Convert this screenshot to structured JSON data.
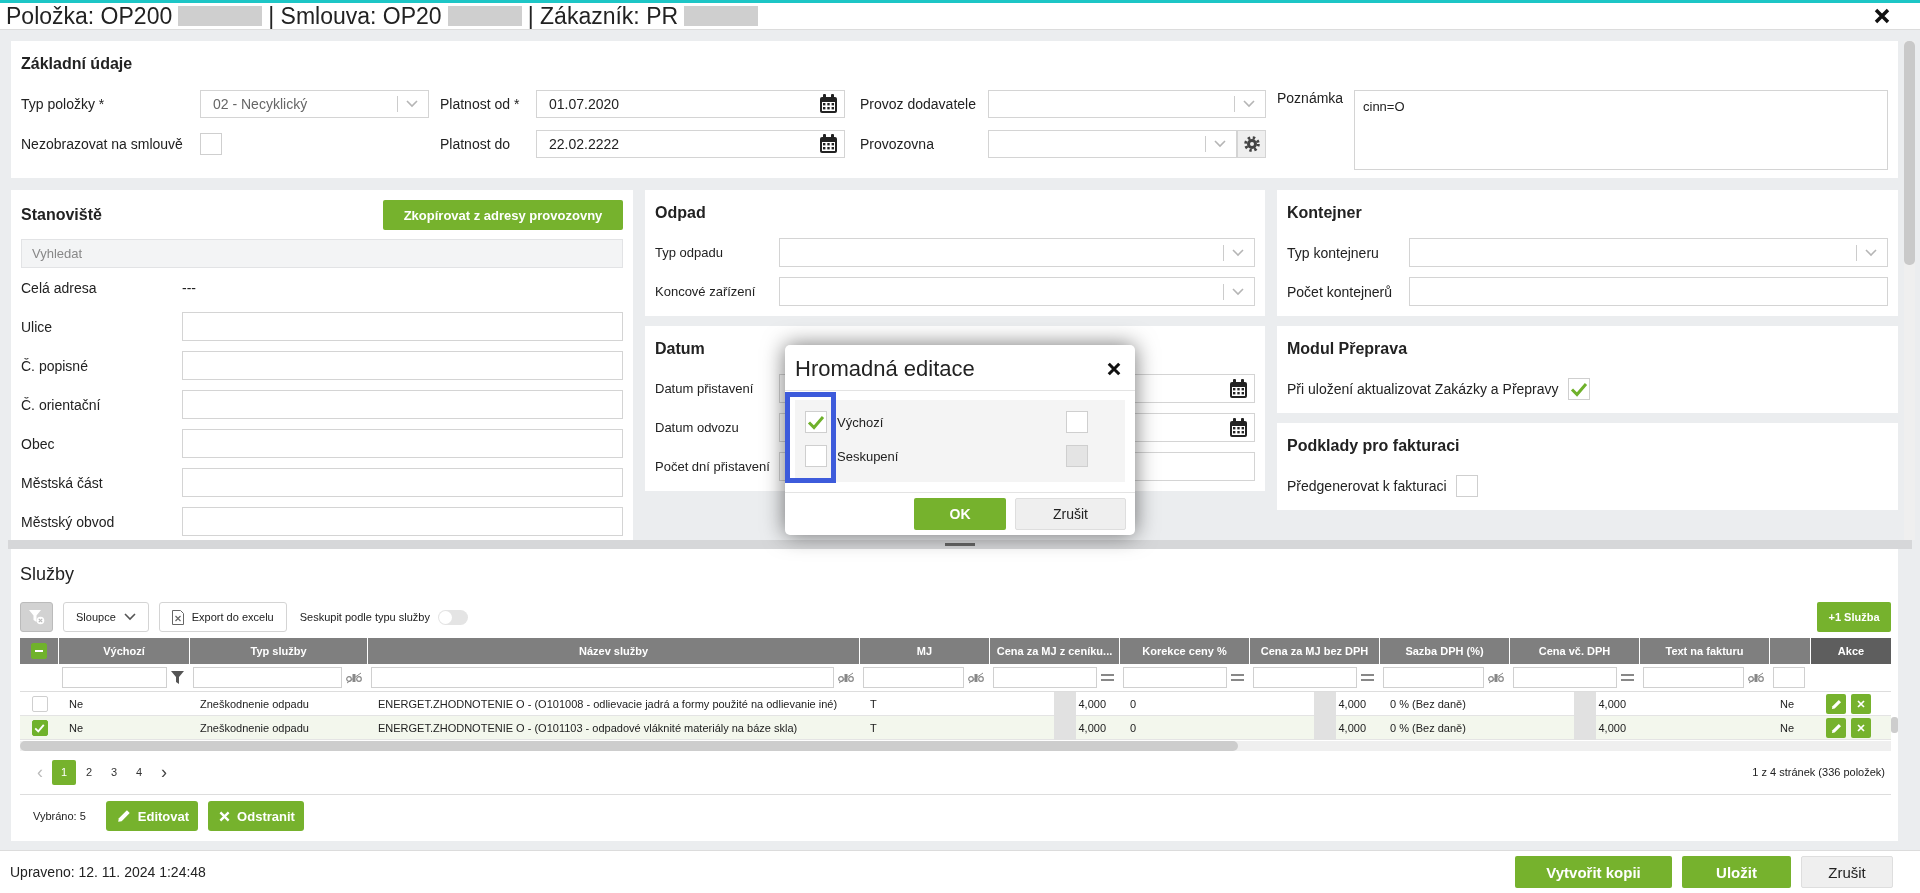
{
  "header": {
    "parts": [
      {
        "text": "Položka: OP200",
        "redacted": true
      },
      {
        "text": "| Smlouva: OP20",
        "redacted": true
      },
      {
        "text": "| Zákazník: PR",
        "redacted": true
      }
    ]
  },
  "basic": {
    "title": "Základní údaje",
    "columns": [
      [
        {
          "kind": "select",
          "label": "Typ položky *",
          "value": "02 - Necyklický",
          "disabled": true
        },
        {
          "kind": "checkbox",
          "label": "Nezobrazovat na smlouvě",
          "checked": false
        }
      ],
      [
        {
          "kind": "date",
          "label": "Platnost od *",
          "value": "01.07.2020"
        },
        {
          "kind": "date",
          "label": "Platnost do",
          "value": "22.02.2222"
        }
      ],
      [
        {
          "kind": "select",
          "label": "Provoz dodavatele"
        },
        {
          "kind": "select-gear",
          "label": "Provozovna"
        }
      ],
      [
        {
          "kind": "textarea",
          "label": "Poznámka",
          "value": "cinn=O"
        }
      ]
    ]
  },
  "panels": [
    [
      {
        "title": "Stanoviště",
        "button": "Zkopírovat z adresy provozovny",
        "search": {
          "placeholder": "Vyhledat"
        },
        "fields": [
          {
            "kind": "text",
            "label": "Celá adresa",
            "value": "---"
          },
          {
            "kind": "input",
            "label": "Ulice"
          },
          {
            "kind": "input",
            "label": "Č. popisné"
          },
          {
            "kind": "input",
            "label": "Č. orientační"
          },
          {
            "kind": "input",
            "label": "Obec"
          },
          {
            "kind": "input",
            "label": "Městská část"
          },
          {
            "kind": "input",
            "label": "Městský obvod"
          }
        ]
      }
    ],
    [
      {
        "title": "Odpad",
        "fields": [
          {
            "kind": "select",
            "label": "Typ odpadu"
          },
          {
            "kind": "select",
            "label": "Koncové zařízení"
          }
        ]
      },
      {
        "title": "Datum",
        "fields": [
          {
            "kind": "date",
            "label": "Datum přistavení"
          },
          {
            "kind": "date",
            "label": "Datum odvozu"
          },
          {
            "kind": "input",
            "label": "Počet dní přistavení"
          }
        ]
      }
    ],
    [
      {
        "title": "Kontejner",
        "fields": [
          {
            "kind": "select",
            "label": "Typ kontejneru"
          },
          {
            "kind": "input",
            "label": "Počet kontejnerů"
          }
        ]
      },
      {
        "title": "Modul Přeprava",
        "fields": [
          {
            "kind": "checkbox",
            "label": "Při uložení aktualizovat Zakázky a Přepravy",
            "checked": true
          }
        ]
      },
      {
        "title": "Podklady pro fakturaci",
        "fields": [
          {
            "kind": "checkbox",
            "label": "Předgenerovat k fakturaci",
            "checked": false
          }
        ]
      }
    ]
  ],
  "services": {
    "title": "Služby",
    "toolbar": {
      "clear_filter": {
        "disabled": true
      },
      "columns_button": "Sloupce",
      "export_button": "Export do excelu",
      "group_toggle": {
        "label": "Seskupit podle typu služby",
        "on": false
      },
      "add_button": "+1 Služba"
    },
    "table": {
      "select_all_partial": true,
      "columns": [
        {
          "label": "Výchozí",
          "kind": "list"
        },
        {
          "label": "Typ služby",
          "kind": "text"
        },
        {
          "label": "Název služby",
          "kind": "text"
        },
        {
          "label": "MJ",
          "kind": "text"
        },
        {
          "label": "Cena za MJ z ceníku...",
          "kind": "number"
        },
        {
          "label": "Korekce ceny %",
          "kind": "number"
        },
        {
          "label": "Cena za MJ bez DPH",
          "kind": "number"
        },
        {
          "label": "Sazba DPH (%)",
          "kind": "text"
        },
        {
          "label": "Cena vč. DPH",
          "kind": "number"
        },
        {
          "label": "Text na fakturu",
          "kind": "text"
        },
        {
          "kind": "plain"
        }
      ],
      "actions_label": "Akce",
      "rows": [
        {
          "selected": false,
          "cells": [
            "Ne",
            "Zneškodnenie odpadu",
            "ENERGET.ZHODNOTENIE O - (O101008 - odlievacie jadrá a formy použité na odlievanie iné)",
            "T",
            {
              "text": "4,000",
              "redacted": true
            },
            "0",
            {
              "text": "4,000",
              "redacted": true
            },
            "0 % (Bez daně)",
            {
              "text": "4,000",
              "redacted": true
            },
            null,
            "Ne"
          ]
        },
        {
          "selected": true,
          "cells": [
            "Ne",
            "Zneškodnenie odpadu",
            "ENERGET.ZHODNOTENIE O - (O101103 - odpadové vláknité materiály na báze skla)",
            "T",
            {
              "text": "4,000",
              "redacted": true
            },
            "0",
            {
              "text": "4,000",
              "redacted": true
            },
            "0 % (Bez daně)",
            {
              "text": "4,000",
              "redacted": true
            },
            null,
            "Ne"
          ]
        }
      ]
    },
    "pager": {
      "prev": {
        "label": "‹",
        "disabled": true
      },
      "pages": [
        {
          "label": "1",
          "selected": true
        },
        {
          "label": "2",
          "selected": false
        },
        {
          "label": "3",
          "selected": false
        },
        {
          "label": "4",
          "selected": false
        }
      ],
      "next": {
        "label": "›",
        "disabled": false
      },
      "summary": "1 z 4 stránek (336 položek)"
    },
    "selection": {
      "count": "Vybráno: 5",
      "buttons": [
        {
          "kind": "edit",
          "label": "Editovat"
        },
        {
          "kind": "delete",
          "label": "Odstranit"
        }
      ]
    }
  },
  "footer": {
    "modified": "Upraveno: 12. 11. 2024 1:24:48",
    "buttons": [
      {
        "label": "Vytvořit kopii",
        "kind": "primary"
      },
      {
        "label": "Uložit",
        "kind": "primary"
      },
      {
        "label": "Zrušit",
        "kind": "secondary"
      }
    ]
  },
  "dialog": {
    "title": "Hromadná editace",
    "highlight": true,
    "rows": [
      {
        "label": "Výchozí",
        "checked": true,
        "value_disabled": false
      },
      {
        "label": "Seskupení",
        "checked": false,
        "value_disabled": true
      }
    ],
    "buttons": [
      {
        "label": "OK",
        "kind": "primary"
      },
      {
        "label": "Zrušit",
        "kind": "secondary"
      }
    ]
  }
}
